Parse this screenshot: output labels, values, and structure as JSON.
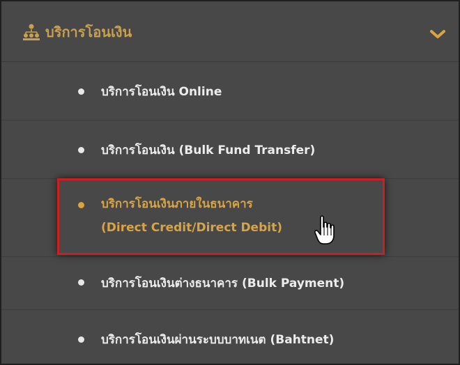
{
  "menu": {
    "header": {
      "label": "บริการโอนเงิน",
      "icon": "org-tree-icon",
      "chevron": "chevron-down-icon"
    },
    "items": [
      {
        "label": "บริการโอนเงิน Online"
      },
      {
        "label": "บริการโอนเงิน (Bulk Fund Transfer)"
      },
      {
        "label_line1": "บริการโอนเงินภายในธนาคาร",
        "label_line2": "(Direct Credit/Direct Debit)",
        "active": true
      },
      {
        "label": "บริการโอนเงินต่างธนาคาร (Bulk Payment)"
      },
      {
        "label": "บริการโอนเงินผ่านระบบบาทเนต (Bahtnet)"
      }
    ]
  },
  "colors": {
    "accent": "#d9a441",
    "text": "#ececec",
    "panel": "#484848",
    "highlight": "#cc1f1f"
  },
  "cursor": {
    "icon": "hand-pointer-icon"
  }
}
